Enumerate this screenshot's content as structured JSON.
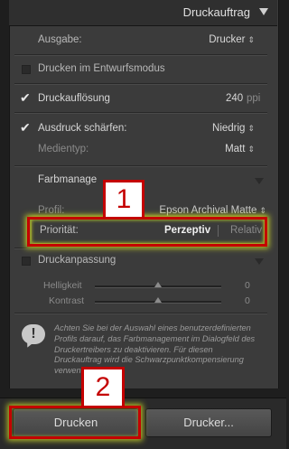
{
  "header": {
    "title": "Druckauftrag"
  },
  "ausgabe": {
    "label": "Ausgabe:",
    "value": "Drucker"
  },
  "entwurf": {
    "label": "Drucken im Entwurfsmodus"
  },
  "aufloesung": {
    "label": "Druckauflösung",
    "value": "240",
    "unit": "ppi"
  },
  "schaerfen": {
    "label": "Ausdruck schärfen:",
    "value": "Niedrig",
    "medientyp_label": "Medientyp:",
    "medientyp_value": "Matt"
  },
  "farbmanagement": {
    "label": "Farbmanage",
    "profil_label": "Profil:",
    "profil_value": "Epson Archival Matte",
    "prioritaet_label": "Priorität:",
    "option_1": "Perzeptiv",
    "option_2": "Relativ"
  },
  "druckanpassung": {
    "label": "Druckanpassung",
    "helligkeit_label": "Helligkeit",
    "helligkeit_value": "0",
    "kontrast_label": "Kontrast",
    "kontrast_value": "0"
  },
  "info_text": "Achten Sie bei der Auswahl eines benutzerdefinierten Profils darauf, das Farbmanagement im Dialogfeld des Druckertreibers zu deaktivieren. Für diesen Druckauftrag wird die Schwarzpunktkompensierung verwendet.",
  "buttons": {
    "print": "Drucken",
    "printer": "Drucker..."
  },
  "callouts": {
    "one": "1",
    "two": "2"
  },
  "colors": {
    "callout": "#c40000",
    "highlight": "#d2dc28"
  }
}
